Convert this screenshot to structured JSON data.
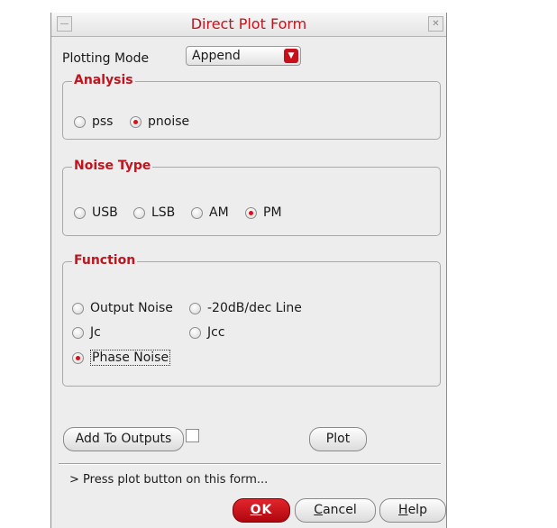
{
  "window": {
    "title": "Direct Plot Form"
  },
  "plotting_mode": {
    "label": "Plotting Mode",
    "value": "Append"
  },
  "analysis": {
    "title": "Analysis",
    "options": [
      "pss",
      "pnoise"
    ],
    "selected": "pnoise"
  },
  "noise_type": {
    "title": "Noise Type",
    "options": [
      "USB",
      "LSB",
      "AM",
      "PM"
    ],
    "selected": "PM"
  },
  "function": {
    "title": "Function",
    "options": [
      "Output Noise",
      "-20dB/dec Line",
      "Jc",
      "Jcc",
      "Phase Noise"
    ],
    "selected": "Phase Noise"
  },
  "buttons": {
    "add_to_outputs": "Add To Outputs",
    "plot": "Plot",
    "ok_accel": "O",
    "ok_rest": "K",
    "cancel_accel": "C",
    "cancel_rest": "ancel",
    "help_accel": "H",
    "help_rest": "elp"
  },
  "status": "> Press plot button on this form...",
  "colors": {
    "accent": "#c0141e",
    "ok_button": "#c8101a"
  }
}
